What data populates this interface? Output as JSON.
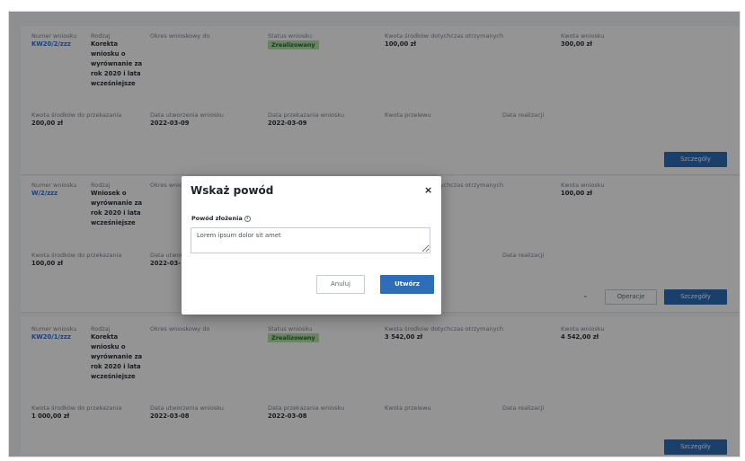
{
  "labels": {
    "numer": "Numer wniosku",
    "rodzaj": "Rodzaj",
    "okres": "Okres wnioskowy do",
    "status": "Status wniosku",
    "kwota_dotychczas": "Kwota środków dotychczas otrzymanych",
    "kwota_wniosku": "Kwota wniosku",
    "kwota_do_przekazania": "Kwota środków do przekazania",
    "data_utworzenia": "Data utworzenia wniosku",
    "data_przekazania": "Data przekazania wniosku",
    "kwota_przelewu": "Kwota przelewu",
    "data_realizacji": "Data realizacji"
  },
  "cards": [
    {
      "numer": "KW20/2/zzz",
      "rodzaj": "Korekta wniosku o wyrównanie za rok 2020 i lata wcześniejsze",
      "status": "Zrealizowany",
      "kwota_dotychczas": "100,00 zł",
      "kwota_wniosku": "300,00 zł",
      "kwota_do_przekazania": "200,00 zł",
      "data_utworzenia": "2022-03-09",
      "data_przekazania": "2022-03-09",
      "details_label": "Szczegóły"
    },
    {
      "numer": "W/2/zzz",
      "rodzaj": "Wniosek o wyrównanie za rok 2020 i lata wcześniejsze",
      "kwota_wniosku": "100,00 zł",
      "kwota_do_przekazania": "100,00 zł",
      "data_utworzenia_partial": "2022-03-",
      "operations_label": "Operacje",
      "details_label": "Szczegóły"
    },
    {
      "numer": "KW20/1/zzz",
      "rodzaj": "Korekta wniosku o wyrównanie za rok 2020 i lata wcześniejsze",
      "status": "Zrealizowany",
      "kwota_dotychczas": "3 542,00 zł",
      "kwota_wniosku": "4 542,00 zł",
      "kwota_do_przekazania": "1 000,00 zł",
      "data_utworzenia": "2022-03-08",
      "data_przekazania": "2022-03-08",
      "details_label": "Szczegóły"
    }
  ],
  "modal": {
    "title": "Wskaż powód",
    "close": "×",
    "field_label": "Powód złożenia",
    "info": "i",
    "field_value": "Lorem ipsum dolor sit amet",
    "cancel_label": "Anuluj",
    "create_label": "Utwórz"
  },
  "icons": {
    "chevron": "chevron-down-icon",
    "info": "info-icon",
    "close": "close-icon"
  },
  "colors": {
    "primary": "#2e6db8",
    "link": "#2f6fd6",
    "status_bg": "#b5e3a8",
    "status_text": "#1f6b33",
    "overlay": "rgba(0,0,0,0.42)"
  }
}
